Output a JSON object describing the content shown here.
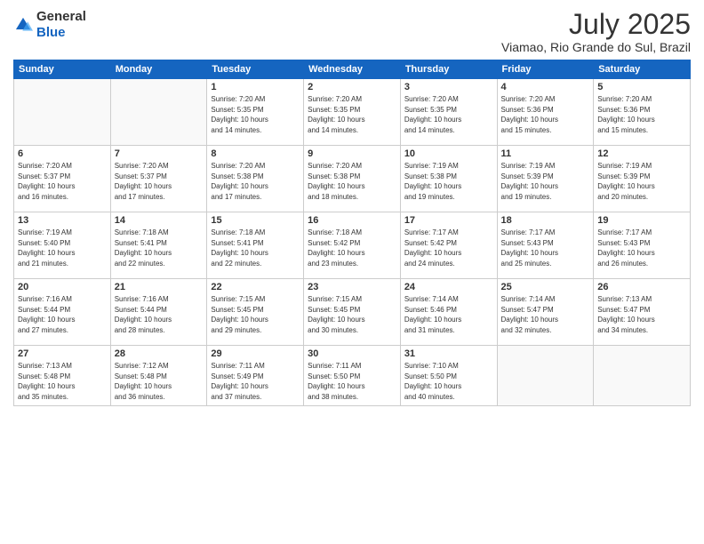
{
  "header": {
    "logo_general": "General",
    "logo_blue": "Blue",
    "month": "July 2025",
    "location": "Viamao, Rio Grande do Sul, Brazil"
  },
  "weekdays": [
    "Sunday",
    "Monday",
    "Tuesday",
    "Wednesday",
    "Thursday",
    "Friday",
    "Saturday"
  ],
  "weeks": [
    [
      {
        "day": "",
        "info": ""
      },
      {
        "day": "",
        "info": ""
      },
      {
        "day": "1",
        "info": "Sunrise: 7:20 AM\nSunset: 5:35 PM\nDaylight: 10 hours\nand 14 minutes."
      },
      {
        "day": "2",
        "info": "Sunrise: 7:20 AM\nSunset: 5:35 PM\nDaylight: 10 hours\nand 14 minutes."
      },
      {
        "day": "3",
        "info": "Sunrise: 7:20 AM\nSunset: 5:35 PM\nDaylight: 10 hours\nand 14 minutes."
      },
      {
        "day": "4",
        "info": "Sunrise: 7:20 AM\nSunset: 5:36 PM\nDaylight: 10 hours\nand 15 minutes."
      },
      {
        "day": "5",
        "info": "Sunrise: 7:20 AM\nSunset: 5:36 PM\nDaylight: 10 hours\nand 15 minutes."
      }
    ],
    [
      {
        "day": "6",
        "info": "Sunrise: 7:20 AM\nSunset: 5:37 PM\nDaylight: 10 hours\nand 16 minutes."
      },
      {
        "day": "7",
        "info": "Sunrise: 7:20 AM\nSunset: 5:37 PM\nDaylight: 10 hours\nand 17 minutes."
      },
      {
        "day": "8",
        "info": "Sunrise: 7:20 AM\nSunset: 5:38 PM\nDaylight: 10 hours\nand 17 minutes."
      },
      {
        "day": "9",
        "info": "Sunrise: 7:20 AM\nSunset: 5:38 PM\nDaylight: 10 hours\nand 18 minutes."
      },
      {
        "day": "10",
        "info": "Sunrise: 7:19 AM\nSunset: 5:38 PM\nDaylight: 10 hours\nand 19 minutes."
      },
      {
        "day": "11",
        "info": "Sunrise: 7:19 AM\nSunset: 5:39 PM\nDaylight: 10 hours\nand 19 minutes."
      },
      {
        "day": "12",
        "info": "Sunrise: 7:19 AM\nSunset: 5:39 PM\nDaylight: 10 hours\nand 20 minutes."
      }
    ],
    [
      {
        "day": "13",
        "info": "Sunrise: 7:19 AM\nSunset: 5:40 PM\nDaylight: 10 hours\nand 21 minutes."
      },
      {
        "day": "14",
        "info": "Sunrise: 7:18 AM\nSunset: 5:41 PM\nDaylight: 10 hours\nand 22 minutes."
      },
      {
        "day": "15",
        "info": "Sunrise: 7:18 AM\nSunset: 5:41 PM\nDaylight: 10 hours\nand 22 minutes."
      },
      {
        "day": "16",
        "info": "Sunrise: 7:18 AM\nSunset: 5:42 PM\nDaylight: 10 hours\nand 23 minutes."
      },
      {
        "day": "17",
        "info": "Sunrise: 7:17 AM\nSunset: 5:42 PM\nDaylight: 10 hours\nand 24 minutes."
      },
      {
        "day": "18",
        "info": "Sunrise: 7:17 AM\nSunset: 5:43 PM\nDaylight: 10 hours\nand 25 minutes."
      },
      {
        "day": "19",
        "info": "Sunrise: 7:17 AM\nSunset: 5:43 PM\nDaylight: 10 hours\nand 26 minutes."
      }
    ],
    [
      {
        "day": "20",
        "info": "Sunrise: 7:16 AM\nSunset: 5:44 PM\nDaylight: 10 hours\nand 27 minutes."
      },
      {
        "day": "21",
        "info": "Sunrise: 7:16 AM\nSunset: 5:44 PM\nDaylight: 10 hours\nand 28 minutes."
      },
      {
        "day": "22",
        "info": "Sunrise: 7:15 AM\nSunset: 5:45 PM\nDaylight: 10 hours\nand 29 minutes."
      },
      {
        "day": "23",
        "info": "Sunrise: 7:15 AM\nSunset: 5:45 PM\nDaylight: 10 hours\nand 30 minutes."
      },
      {
        "day": "24",
        "info": "Sunrise: 7:14 AM\nSunset: 5:46 PM\nDaylight: 10 hours\nand 31 minutes."
      },
      {
        "day": "25",
        "info": "Sunrise: 7:14 AM\nSunset: 5:47 PM\nDaylight: 10 hours\nand 32 minutes."
      },
      {
        "day": "26",
        "info": "Sunrise: 7:13 AM\nSunset: 5:47 PM\nDaylight: 10 hours\nand 34 minutes."
      }
    ],
    [
      {
        "day": "27",
        "info": "Sunrise: 7:13 AM\nSunset: 5:48 PM\nDaylight: 10 hours\nand 35 minutes."
      },
      {
        "day": "28",
        "info": "Sunrise: 7:12 AM\nSunset: 5:48 PM\nDaylight: 10 hours\nand 36 minutes."
      },
      {
        "day": "29",
        "info": "Sunrise: 7:11 AM\nSunset: 5:49 PM\nDaylight: 10 hours\nand 37 minutes."
      },
      {
        "day": "30",
        "info": "Sunrise: 7:11 AM\nSunset: 5:50 PM\nDaylight: 10 hours\nand 38 minutes."
      },
      {
        "day": "31",
        "info": "Sunrise: 7:10 AM\nSunset: 5:50 PM\nDaylight: 10 hours\nand 40 minutes."
      },
      {
        "day": "",
        "info": ""
      },
      {
        "day": "",
        "info": ""
      }
    ]
  ]
}
